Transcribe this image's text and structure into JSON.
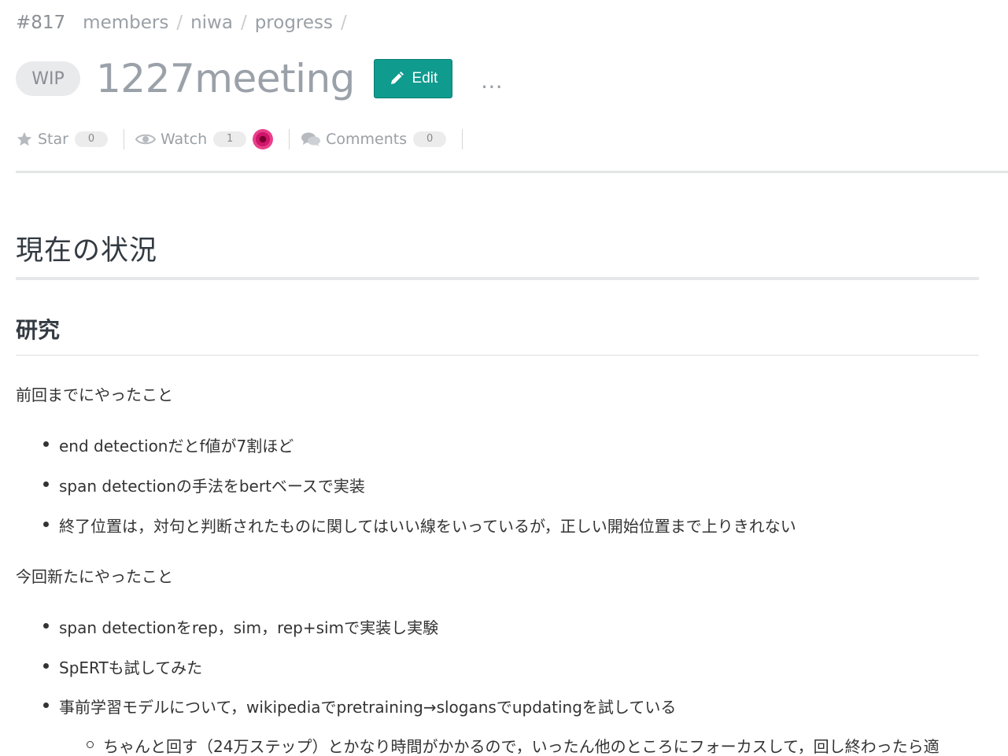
{
  "breadcrumb": {
    "post_number": "#817",
    "items": [
      "members",
      "niwa",
      "progress"
    ],
    "separator": "/"
  },
  "header": {
    "wip_badge": "WIP",
    "title": "1227meeting",
    "edit_label": "Edit",
    "more_label": "…"
  },
  "meta": {
    "star_label": "Star",
    "star_count": "0",
    "watch_label": "Watch",
    "watch_count": "1",
    "comments_label": "Comments",
    "comments_count": "0"
  },
  "content": {
    "h1": "現在の状況",
    "h2": "研究",
    "previous_label": "前回までにやったこと",
    "previous_items": [
      "end detectionだとf値が7割ほど",
      "span detectionの手法をbertベースで実装",
      "終了位置は，対句と判断されたものに関してはいい線をいっているが，正しい開始位置まで上りきれない"
    ],
    "current_label": "今回新たにやったこと",
    "current_items": [
      "span detectionをrep，sim，rep+simで実装し実験",
      "SpERTも試してみた",
      "事前学習モデルについて，wikipediaでpretraining→slogansでupdatingを試している"
    ],
    "current_subitems": [
      "ちゃんと回す（24万ステップ）とかなり時間がかかるので，いったん他のところにフォーカスして，回し終わったら適"
    ]
  },
  "colors": {
    "edit_button": "#0f9b8e",
    "muted_text": "#9aa0a6",
    "heading_text": "#333a42"
  }
}
